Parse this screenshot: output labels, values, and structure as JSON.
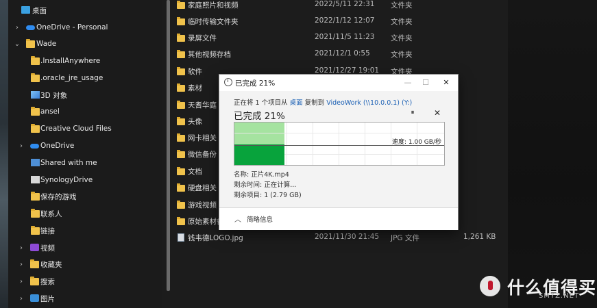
{
  "nav": {
    "items": [
      {
        "label": "桌面",
        "icon": "desktop-icon"
      },
      {
        "label": "OneDrive - Personal",
        "icon": "cloud-icon"
      },
      {
        "label": "Wade",
        "icon": "folder-icon"
      },
      {
        "label": ".InstallAnywhere",
        "icon": "folder-icon"
      },
      {
        "label": ".oracle_jre_usage",
        "icon": "folder-icon"
      },
      {
        "label": "3D 对象",
        "icon": "cube-icon"
      },
      {
        "label": "ansel",
        "icon": "folder-icon"
      },
      {
        "label": "Creative Cloud Files",
        "icon": "folder-icon"
      },
      {
        "label": "OneDrive",
        "icon": "cloud-icon"
      },
      {
        "label": "Shared with me",
        "icon": "shared-icon"
      },
      {
        "label": "SynologyDrive",
        "icon": "sync-icon"
      },
      {
        "label": "保存的游戏",
        "icon": "folder-icon"
      },
      {
        "label": "联系人",
        "icon": "folder-icon"
      },
      {
        "label": "链接",
        "icon": "folder-icon"
      },
      {
        "label": "视频",
        "icon": "video-icon"
      },
      {
        "label": "收藏夹",
        "icon": "folder-icon"
      },
      {
        "label": "搜索",
        "icon": "folder-icon"
      },
      {
        "label": "图片",
        "icon": "picture-icon"
      }
    ]
  },
  "files": [
    {
      "name": "家庭照片和视频",
      "date": "2022/5/11 22:31",
      "type": "文件夹",
      "size": ""
    },
    {
      "name": "临时传输文件夹",
      "date": "2022/1/12 12:07",
      "type": "文件夹",
      "size": ""
    },
    {
      "name": "录屏文件",
      "date": "2021/11/5 11:23",
      "type": "文件夹",
      "size": ""
    },
    {
      "name": "其他视频存档",
      "date": "2021/12/1 0:55",
      "type": "文件夹",
      "size": ""
    },
    {
      "name": "软件",
      "date": "2021/12/27 19:01",
      "type": "文件夹",
      "size": ""
    },
    {
      "name": "素材",
      "date": "",
      "type": "",
      "size": ""
    },
    {
      "name": "天耆华庭",
      "date": "",
      "type": "",
      "size": ""
    },
    {
      "name": "头像",
      "date": "",
      "type": "",
      "size": ""
    },
    {
      "name": "网卡相关",
      "date": "",
      "type": "",
      "size": ""
    },
    {
      "name": "微信备份",
      "date": "",
      "type": "",
      "size": ""
    },
    {
      "name": "文档",
      "date": "",
      "type": "",
      "size": ""
    },
    {
      "name": "硬盘相关",
      "date": "",
      "type": "",
      "size": ""
    },
    {
      "name": "游戏视频",
      "date": "",
      "type": "",
      "size": ""
    },
    {
      "name": "原始素材备",
      "date": "",
      "type": "",
      "size": ""
    },
    {
      "name": "钱韦德LOGO.jpg",
      "date": "2021/11/30 21:45",
      "type": "JPG 文件",
      "size": "1,261 KB"
    }
  ],
  "dialog": {
    "title": "已完成 21%",
    "minimize": "—",
    "maximize": "☐",
    "close": "✕",
    "copy_prefix": "正在将 1 个项目从",
    "copy_from": "桌面",
    "copy_mid": "复制到",
    "copy_to": "VideoWork (\\\\10.0.0.1) (Y:)",
    "percent_text": "已完成 21%",
    "progress": 0.21,
    "pause_symbol": "⏸",
    "cancel_symbol": "✕",
    "speed": "速度: 1.00 GB/秒",
    "name_line": "名称: 正片4K.mp4",
    "time_line": "剩余时间: 正在计算...",
    "items_line": "剩余项目: 1 (2.79 GB)",
    "footer_label": "简略信息",
    "colors": {
      "done_area": "#a5e3a0",
      "speed_fill": "#08a33c",
      "link": "#1a5fb4"
    }
  },
  "watermark": {
    "text": "值 什么值得买",
    "sub": "SMYZ.NET"
  }
}
